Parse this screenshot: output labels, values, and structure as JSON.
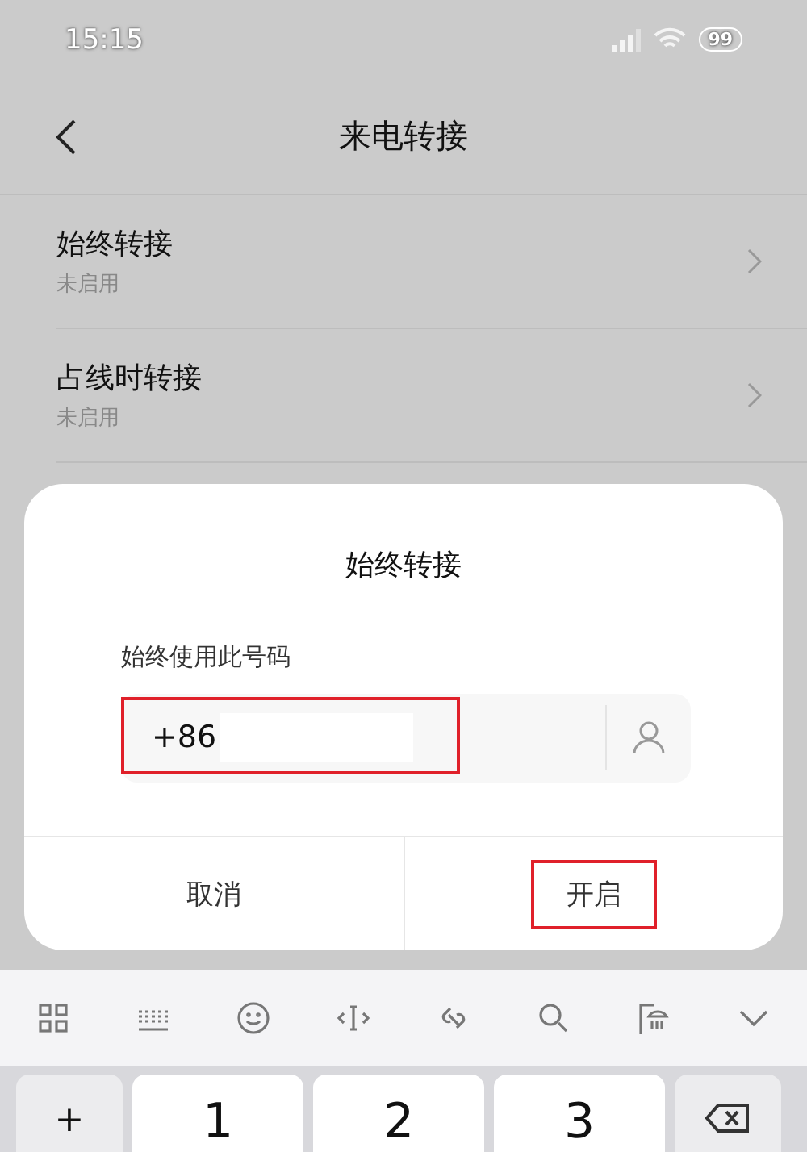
{
  "status_bar": {
    "time": "15:15",
    "battery": "99"
  },
  "header": {
    "title": "来电转接"
  },
  "settings": [
    {
      "title": "始终转接",
      "status": "未启用"
    },
    {
      "title": "占线时转接",
      "status": "未启用"
    }
  ],
  "dialog": {
    "title": "始终转接",
    "label": "始终使用此号码",
    "field": {
      "value": "+86",
      "highlighted": true
    },
    "buttons": [
      {
        "label": "取消",
        "highlighted": false
      },
      {
        "label": "开启",
        "highlighted": true
      }
    ]
  },
  "keyboard": {
    "keys": [
      {
        "kind": "symbol",
        "label": "+"
      },
      {
        "kind": "digit",
        "label": "1"
      },
      {
        "kind": "digit",
        "label": "2"
      },
      {
        "kind": "digit",
        "label": "3"
      },
      {
        "kind": "backspace"
      }
    ]
  }
}
